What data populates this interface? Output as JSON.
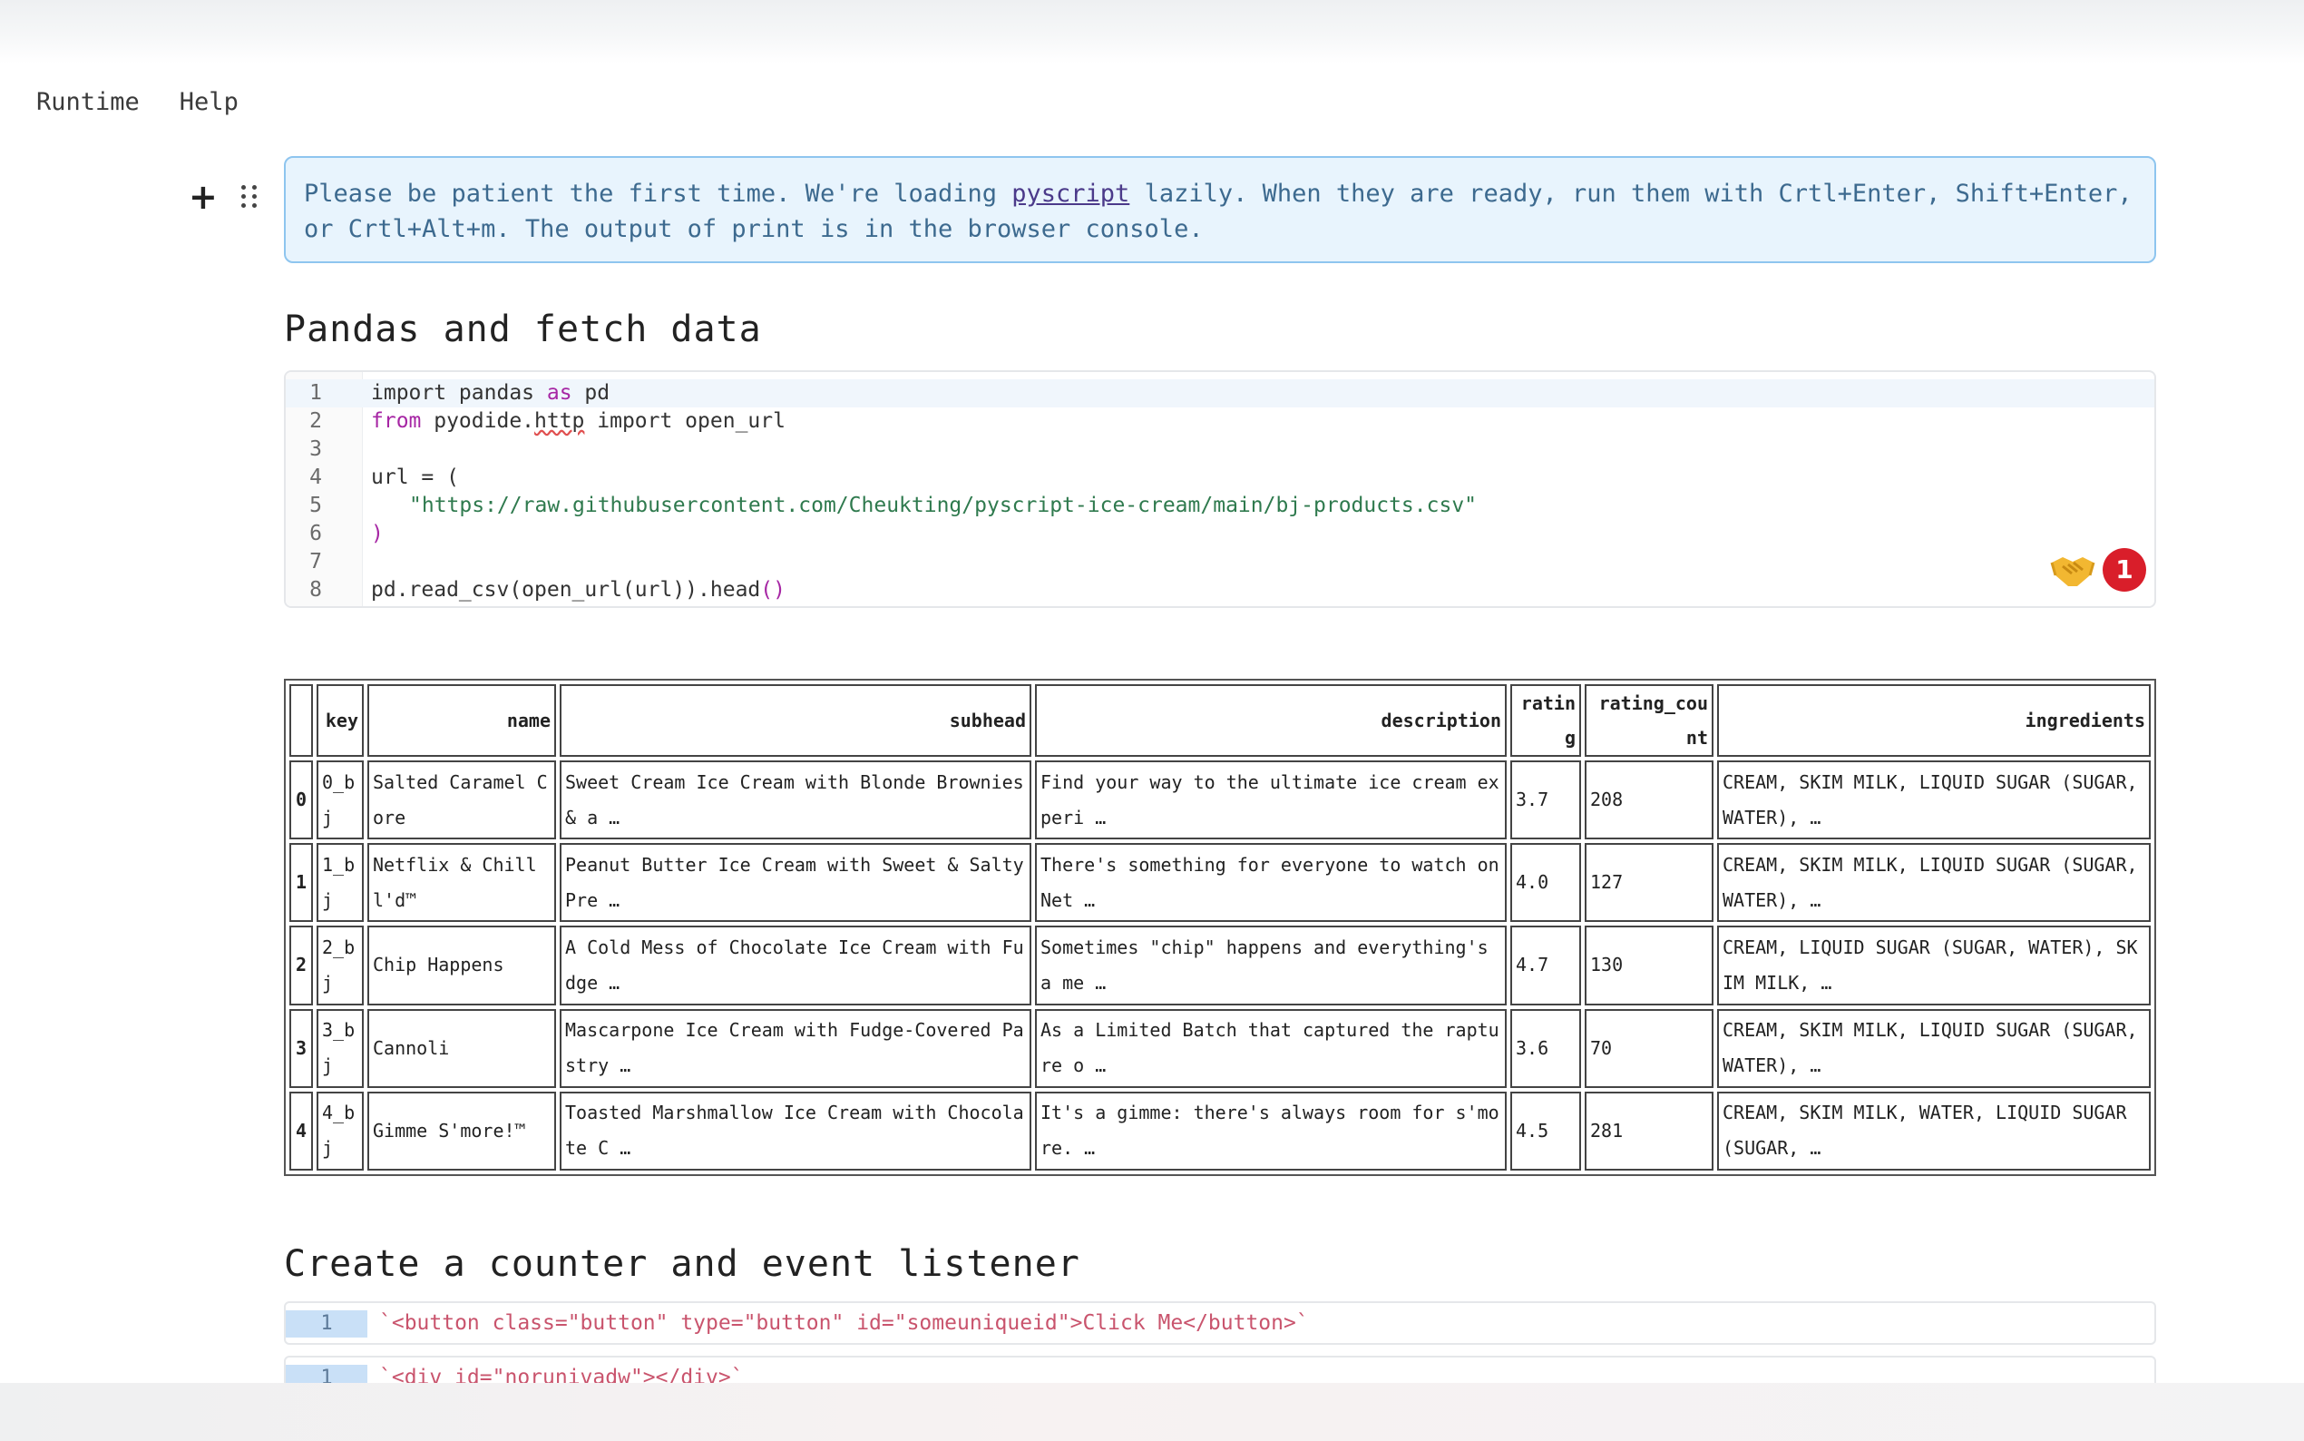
{
  "menu": [
    "Runtime",
    "Help"
  ],
  "notice": {
    "before": "Please be patient the first time. We're loading ",
    "link": "pyscript",
    "after": " lazily. When they are ready, run them with Crtl+Enter, Shift+Enter, or  Crtl+Alt+m. The output of print is in the browser console."
  },
  "section1": {
    "title": "Pandas and fetch data"
  },
  "code": {
    "line_numbers": [
      "1",
      "2",
      "3",
      "4",
      "5",
      "6",
      "7",
      "8"
    ],
    "l1a": "import pandas ",
    "l1b": "as",
    "l1c": " pd",
    "l2a": "from",
    "l2b": " pyodide.",
    "l2c": "http",
    "l2d": " import open_url",
    "l4": "url = (",
    "l5": "\"https://raw.githubusercontent.com/Cheukting/pyscript-ice-cream/main/bj-products.csv\"",
    "l6": ")",
    "l8a": "pd.read_csv(open_url(url)).head",
    "l8b": "()"
  },
  "reaction": {
    "icon": "handshake-icon",
    "count": "1"
  },
  "table": {
    "headers": [
      "",
      "key",
      "name",
      "subhead",
      "description",
      "ratin g",
      "rating_cou nt",
      "ingredients"
    ],
    "rows": [
      {
        "idx": "0",
        "key": "0_b j",
        "name": "Salted Caramel Core",
        "subhead": "Sweet Cream Ice Cream with Blonde Brownies & a …",
        "description": "Find your way to the ultimate ice cream experi …",
        "rating": "3.7",
        "rating_count": "208",
        "ingredients": "CREAM, SKIM MILK, LIQUID SUGAR (SUGAR, WATER), …"
      },
      {
        "idx": "1",
        "key": "1_b j",
        "name": "Netflix & Chilll'd™",
        "subhead": "Peanut Butter Ice Cream with Sweet & Salty Pre …",
        "description": "There's something for everyone to watch on Net …",
        "rating": "4.0",
        "rating_count": "127",
        "ingredients": "CREAM, SKIM MILK, LIQUID SUGAR (SUGAR, WATER), …"
      },
      {
        "idx": "2",
        "key": "2_b j",
        "name": "Chip Happens",
        "subhead": "A Cold Mess of Chocolate Ice Cream with Fudge …",
        "description": "Sometimes \"chip\" happens and everything's a me …",
        "rating": "4.7",
        "rating_count": "130",
        "ingredients": "CREAM, LIQUID SUGAR (SUGAR, WATER), SKIM MILK, …"
      },
      {
        "idx": "3",
        "key": "3_b j",
        "name": "Cannoli",
        "subhead": "Mascarpone Ice Cream with Fudge-Covered Pastry …",
        "description": "As a Limited Batch that captured the rapture o …",
        "rating": "3.6",
        "rating_count": "70",
        "ingredients": "CREAM, SKIM MILK, LIQUID SUGAR (SUGAR, WATER), …"
      },
      {
        "idx": "4",
        "key": "4_b j",
        "name": "Gimme S'more!™",
        "subhead": "Toasted Marshmallow Ice Cream with Chocolate C …",
        "description": "It's a gimme: there's always room for s'more. …",
        "rating": "4.5",
        "rating_count": "281",
        "ingredients": "CREAM, SKIM MILK, WATER, LIQUID SUGAR (SUGAR, …"
      }
    ]
  },
  "section2": {
    "title": "Create a counter and event listener"
  },
  "cell2": {
    "num": "1",
    "text": "`<button class=\"button\" type=\"button\" id=\"someuniqueid\">Click Me</button>`"
  },
  "cell3": {
    "num": "1",
    "text": "`<div id=\"norunivadw\"></div>`"
  },
  "colors": {
    "notice_bg": "#e8f4fd",
    "notice_border": "#8ec5ef",
    "badge": "#d91e2a",
    "string": "#2f7a4e",
    "keyword": "#a626a4"
  }
}
